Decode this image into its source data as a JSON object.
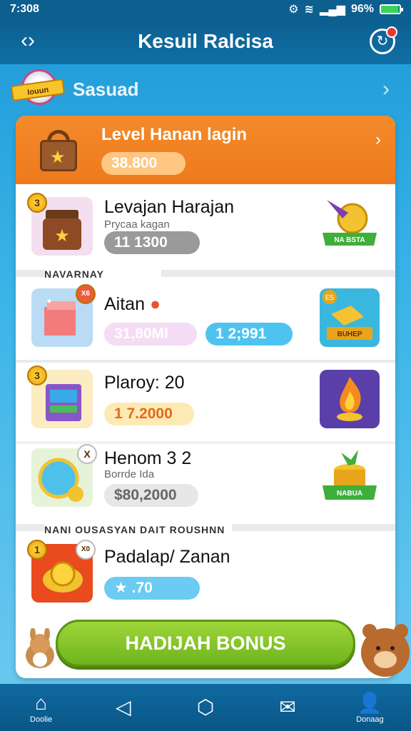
{
  "status": {
    "time": "7:308",
    "battery": "96%"
  },
  "header": {
    "title": "Kesuil Ralcisa"
  },
  "subheader": {
    "badge": "Iouun",
    "label": "Sasuad"
  },
  "featured": {
    "title": "Level Hanan lagin",
    "value": "38.800"
  },
  "rows": [
    {
      "title": "Levajan Harajan",
      "sub": "Prycaa kagan",
      "value": "11 1300",
      "badge": "3",
      "art_label": "NA BSTA"
    },
    {
      "title": "Aitan",
      "value": "31,80MI",
      "value2": "1 2;991",
      "badge": "X6",
      "art_badge": "E5",
      "art_label": "BUHEP"
    },
    {
      "title": "Plaroy: 20",
      "value": "1 7.2000",
      "badge": "3"
    },
    {
      "title": "Henom 3 2",
      "sub": "Borrde Ida",
      "value": "$80,2000",
      "badge": "X",
      "art_label": "NABUA"
    },
    {
      "title": "Padalap/ Zanan",
      "value": "★ .70",
      "badge": "1",
      "badge2": "X0"
    }
  ],
  "sections": {
    "s1": "NAVARNAY",
    "s2": "NANI OUSASYAN DAIT ROUSHNN"
  },
  "button": {
    "label": "HADIJAH BONUS"
  },
  "nav": [
    {
      "label": "Doolie"
    },
    {
      "label": ""
    },
    {
      "label": ""
    },
    {
      "label": ""
    },
    {
      "label": "Donaag"
    }
  ]
}
